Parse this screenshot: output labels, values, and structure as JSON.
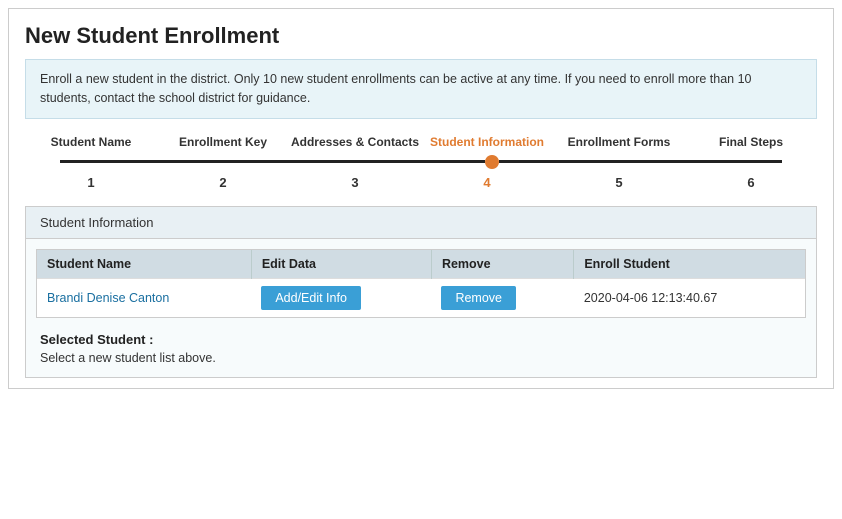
{
  "page": {
    "title": "New Student Enrollment",
    "banner": "Enroll a new student in the district. Only 10 new student enrollments can be active at any time. If you need to enroll more than 10 students, contact the school district for guidance."
  },
  "steps": {
    "labels": [
      "Student Name",
      "Enrollment Key",
      "Addresses & Contacts",
      "Student Information",
      "Enrollment Forms",
      "Final Steps"
    ],
    "numbers": [
      "1",
      "2",
      "3",
      "4",
      "5",
      "6"
    ],
    "active_index": 3
  },
  "section": {
    "header": "Student Information"
  },
  "table": {
    "columns": [
      "Student Name",
      "Edit Data",
      "Remove",
      "Enroll Student"
    ],
    "rows": [
      {
        "student_name": "Brandi Denise Canton",
        "edit_btn": "Add/Edit Info",
        "remove_btn": "Remove",
        "enroll_date": "2020-04-06 12:13:40.67"
      }
    ]
  },
  "selected": {
    "label": "Selected Student :",
    "hint": "Select a new student list above."
  }
}
